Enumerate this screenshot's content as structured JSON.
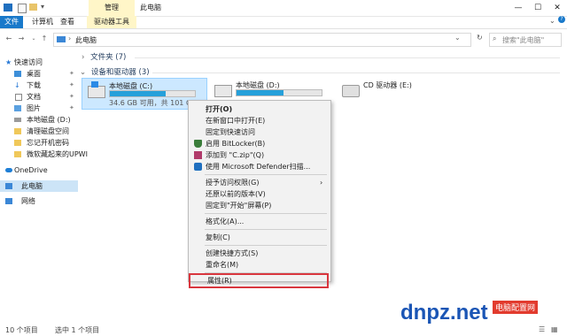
{
  "window": {
    "contextual_tab": "管理",
    "title": "此电脑",
    "controls": [
      "minimize-icon",
      "maximize-icon",
      "close-icon"
    ]
  },
  "ribbon": {
    "tabs": [
      "文件",
      "计算机",
      "查看"
    ],
    "contextual": "驱动器工具"
  },
  "address": {
    "path": "此电脑",
    "search_placeholder": "搜索\"此电脑\""
  },
  "sidebar": {
    "quick_access": "快速访问",
    "items": [
      "桌面",
      "下载",
      "文档",
      "图片",
      "本地磁盘 (D:)",
      "清理磁盘空间",
      "忘记开机密码",
      "微软藏起来的UPWI"
    ],
    "onedrive": "OneDrive",
    "thispc": "此电脑",
    "network": "网络"
  },
  "main": {
    "folders_header": "文件夹 (7)",
    "devices_header": "设备和驱动器 (3)",
    "drives": [
      {
        "name": "本地磁盘 (C:)",
        "info": "34.6 GB 可用，共 101 GB",
        "used_fraction": 0.66
      },
      {
        "name": "本地磁盘 (D:)",
        "used_fraction": 0.55
      },
      {
        "name": "CD 驱动器 (E:)"
      }
    ]
  },
  "context_menu": {
    "items": [
      {
        "label": "打开(O)",
        "bold": true
      },
      {
        "label": "在新窗口中打开(E)"
      },
      {
        "label": "固定到快速访问"
      },
      {
        "label": "启用 BitLocker(B)",
        "icon": "shield-icon"
      },
      {
        "label": "添加到 \"C.zip\"(Q)",
        "icon": "archive-icon"
      },
      {
        "label": "使用 Microsoft Defender扫描...",
        "icon": "defender-icon"
      },
      {
        "separator": true
      },
      {
        "label": "授予访问权限(G)",
        "submenu": true
      },
      {
        "label": "还原以前的版本(V)"
      },
      {
        "label": "固定到\"开始\"屏幕(P)"
      },
      {
        "separator": true
      },
      {
        "label": "格式化(A)..."
      },
      {
        "separator": true
      },
      {
        "label": "复制(C)"
      },
      {
        "separator": true
      },
      {
        "label": "创建快捷方式(S)"
      },
      {
        "label": "重命名(M)"
      },
      {
        "separator": true
      },
      {
        "label": "属性(R)",
        "highlight": true
      }
    ]
  },
  "status": {
    "count": "10 个项目",
    "selected": "选中 1 个项目"
  },
  "watermark": {
    "brand": "dnpz.net",
    "text": "电脑配置网"
  },
  "colors": {
    "accent": "#1979ca",
    "selection": "#cce8ff",
    "contextual": "#fff6c8",
    "highlight_border": "#d9363e",
    "drive_fill": "#26a0da"
  }
}
